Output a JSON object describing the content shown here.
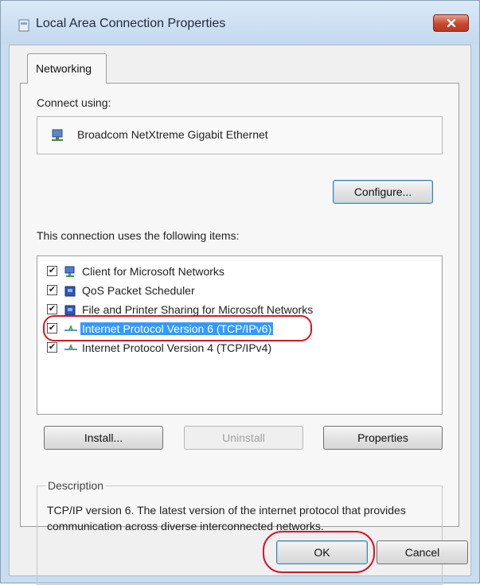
{
  "window": {
    "title": "Local Area Connection Properties"
  },
  "tabs": [
    {
      "label": "Networking"
    }
  ],
  "connect_using": {
    "label": "Connect using:",
    "adapter": "Broadcom NetXtreme Gigabit Ethernet",
    "configure_label": "Configure..."
  },
  "items_section": {
    "label": "This connection uses the following items:",
    "items": [
      {
        "label": "Client for Microsoft Networks",
        "checked": true,
        "icon": "network-client-icon"
      },
      {
        "label": "QoS Packet Scheduler",
        "checked": true,
        "icon": "network-service-icon"
      },
      {
        "label": "File and Printer Sharing for Microsoft Networks",
        "checked": true,
        "icon": "network-service-icon"
      },
      {
        "label": "Internet Protocol Version 6 (TCP/IPv6)",
        "checked": true,
        "icon": "protocol-icon",
        "selected": true
      },
      {
        "label": "Internet Protocol Version 4 (TCP/IPv4)",
        "checked": true,
        "icon": "protocol-icon"
      }
    ]
  },
  "actions": {
    "install_label": "Install...",
    "uninstall_label": "Uninstall",
    "properties_label": "Properties"
  },
  "description": {
    "title": "Description",
    "text": "TCP/IP version 6. The latest version of the internet protocol that provides communication across diverse interconnected networks."
  },
  "footer": {
    "ok_label": "OK",
    "cancel_label": "Cancel"
  },
  "colors": {
    "selection": "#3399ff",
    "highlight_ring": "#d11a2a",
    "close_button": "#c9452c"
  }
}
